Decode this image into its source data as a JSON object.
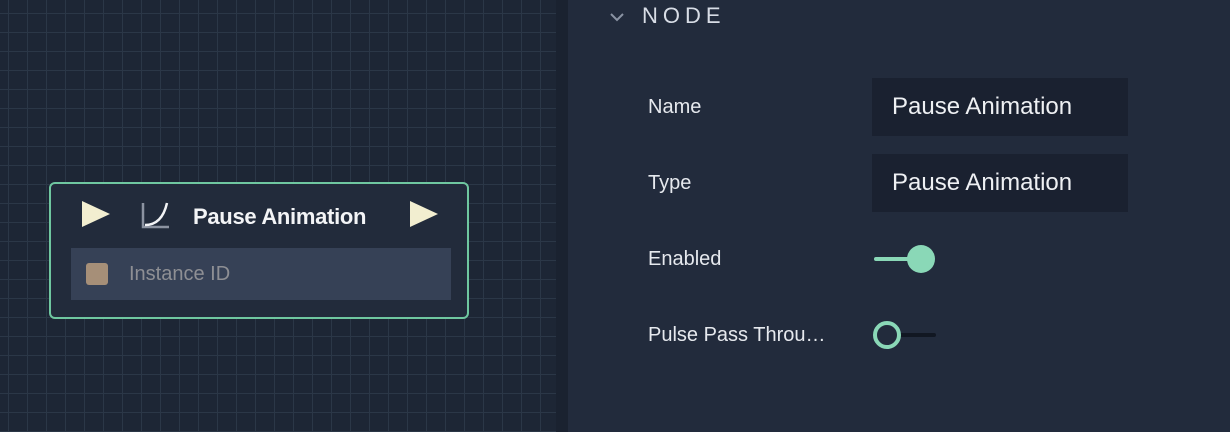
{
  "graph": {
    "node": {
      "title": "Pause Animation",
      "input_pin_label": "Instance ID",
      "icons": [
        "play-input-icon",
        "curve-icon",
        "play-output-icon"
      ]
    }
  },
  "panel": {
    "section_title": "NODE",
    "section_icon": "chevron-down-icon",
    "properties": {
      "name_label": "Name",
      "name_value": "Pause Animation",
      "type_label": "Type",
      "type_value": "Pause Animation",
      "enabled_label": "Enabled",
      "enabled_on": true,
      "pulse_label": "Pulse Pass Throu…",
      "pulse_on": false
    }
  },
  "colors": {
    "accent": "#8ad8b7",
    "node_border": "#6fc7a0",
    "pin": "#a68f78",
    "pulse_arrow": "#f2eed0"
  }
}
